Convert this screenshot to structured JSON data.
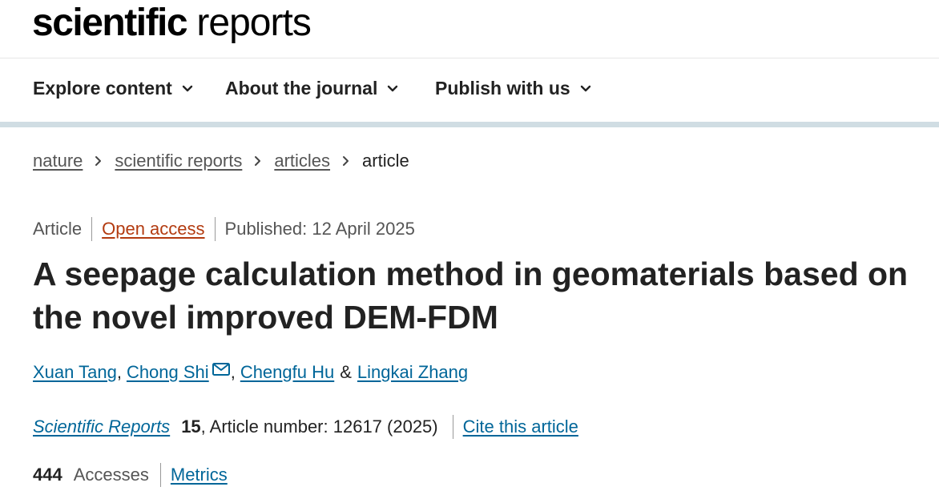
{
  "logo": {
    "bold": "scientific",
    "light": "reports"
  },
  "nav": {
    "items": [
      {
        "label": "Explore content"
      },
      {
        "label": "About the journal"
      },
      {
        "label": "Publish with us"
      }
    ]
  },
  "breadcrumb": {
    "items": [
      "nature",
      "scientific reports",
      "articles"
    ],
    "current": "article"
  },
  "meta": {
    "type": "Article",
    "access": "Open access",
    "published": "Published: 12 April 2025"
  },
  "title": "A seepage calculation method in geomaterials based on the novel improved DEM-FDM",
  "authors": {
    "list": [
      "Xuan Tang",
      "Chong Shi",
      "Chengfu Hu",
      "Lingkai Zhang"
    ],
    "sep1": ",",
    "sep2": ",",
    "amp": "&"
  },
  "citation": {
    "journal": "Scientific Reports",
    "volume": "15",
    "article_number": ", Article number: 12617 (2025)",
    "cite_label": "Cite this article"
  },
  "metrics": {
    "count": "444",
    "accesses_label": "Accesses",
    "metrics_label": "Metrics"
  },
  "colors": {
    "link": "#006699",
    "open_access": "#b33b10",
    "nav_rule": "#d0dde3"
  }
}
